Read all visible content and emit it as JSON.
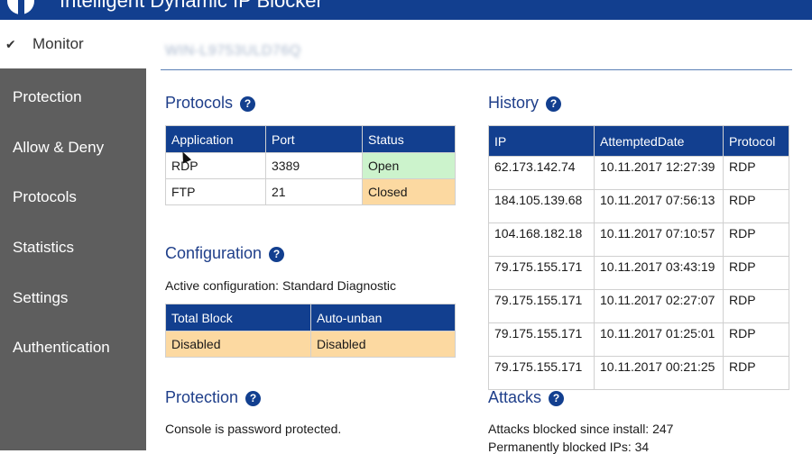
{
  "app": {
    "title": "Intelligent Dynamic IP Blocker",
    "host_name": "WIN-L9753ULD76Q"
  },
  "sidebar": {
    "items": [
      {
        "label": "Monitor",
        "active": true
      },
      {
        "label": "Protection"
      },
      {
        "label": "Allow & Deny"
      },
      {
        "label": "Protocols"
      },
      {
        "label": "Statistics"
      },
      {
        "label": "Settings"
      },
      {
        "label": "Authentication"
      }
    ]
  },
  "protocols": {
    "title": "Protocols",
    "help": "?",
    "columns": [
      "Application",
      "Port",
      "Status"
    ],
    "rows": [
      {
        "application": "RDP",
        "port": "3389",
        "status": "Open"
      },
      {
        "application": "FTP",
        "port": "21",
        "status": "Closed"
      }
    ]
  },
  "configuration": {
    "title": "Configuration",
    "help": "?",
    "active_text": "Active configuration: Standard Diagnostic",
    "columns": [
      "Total Block",
      "Auto-unban"
    ],
    "values": [
      "Disabled",
      "Disabled"
    ]
  },
  "protection": {
    "title": "Protection",
    "help": "?",
    "text": "Console is password protected."
  },
  "history": {
    "title": "History",
    "help": "?",
    "columns": [
      "IP",
      "AttemptedDate",
      "Protocol"
    ],
    "rows": [
      {
        "ip": "62.173.142.74",
        "date": "10.11.2017 12:27:39",
        "protocol": "RDP"
      },
      {
        "ip": "184.105.139.68",
        "date": "10.11.2017 07:56:13",
        "protocol": "RDP"
      },
      {
        "ip": "104.168.182.18",
        "date": "10.11.2017 07:10:57",
        "protocol": "RDP"
      },
      {
        "ip": "79.175.155.171",
        "date": "10.11.2017 03:43:19",
        "protocol": "RDP"
      },
      {
        "ip": "79.175.155.171",
        "date": "10.11.2017 02:27:07",
        "protocol": "RDP"
      },
      {
        "ip": "79.175.155.171",
        "date": "10.11.2017 01:25:01",
        "protocol": "RDP"
      },
      {
        "ip": "79.175.155.171",
        "date": "10.11.2017 00:21:25",
        "protocol": "RDP"
      }
    ]
  },
  "attacks": {
    "title": "Attacks",
    "help": "?",
    "since_install": "Attacks blocked since install: 247",
    "permanently_blocked": "Permanently blocked IPs: 34"
  },
  "colors": {
    "brand": "#123f8f",
    "sidebar": "#5e5e5e",
    "status_open": "#ccf3cc",
    "status_closed": "#fcd9a1"
  }
}
